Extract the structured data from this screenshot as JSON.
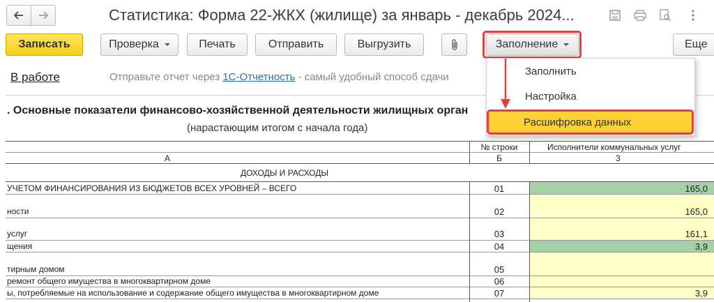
{
  "window": {
    "title": "Статистика: Форма 22-ЖКХ (жилище) за январь - декабрь 2024..."
  },
  "toolbar": {
    "save_label": "Записать",
    "check_label": "Проверка",
    "print_label": "Печать",
    "send_label": "Отправить",
    "export_label": "Выгрузить",
    "fill_label": "Заполнение",
    "more_label": "Еще"
  },
  "status": {
    "state": "В работе",
    "hint_prefix": "Отправьте отчет через",
    "hint_link": "1С-Отчетность",
    "hint_suffix": "- самый удобный способ сдачи"
  },
  "fill_menu": {
    "items": [
      "Заполнить",
      "Настройка",
      "Расшифровка данных"
    ]
  },
  "report": {
    "section_title": ". Основные показатели финансово-хозяйственной деятельности жилищных орган",
    "section_subtitle": "(нарастающим итогом с начала года)",
    "col_header_rownum": "№ строки",
    "col_header_providers": "Исполнители коммунальных услуг",
    "col_letter_a": "А",
    "col_letter_b": "Б",
    "col_number_3": "3",
    "group_title": "ДОХОДЫ И РАСХОДЫ",
    "rows": [
      {
        "label": "УЧЕТОМ ФИНАНСИРОВАНИЯ ИЗ БЮДЖЕТОВ ВСЕХ УРОВНЕЙ – ВСЕГО",
        "num": "01",
        "value": "165,0"
      },
      {
        "label": "ности",
        "num": "02",
        "value": "165,0"
      },
      {
        "label": "услуг",
        "num": "03",
        "value": "161,1"
      },
      {
        "label": "щения",
        "num": "04",
        "value": "3,9"
      },
      {
        "label": "тирным домом",
        "num": "05",
        "value": ""
      },
      {
        "label": "ремонт общего имущества в многоквартирном доме",
        "num": "06",
        "value": ""
      },
      {
        "label": "ы, потребляемые на использование и содержание общего имущества в многоквартирном доме",
        "num": "07",
        "value": "3,9"
      }
    ]
  }
}
